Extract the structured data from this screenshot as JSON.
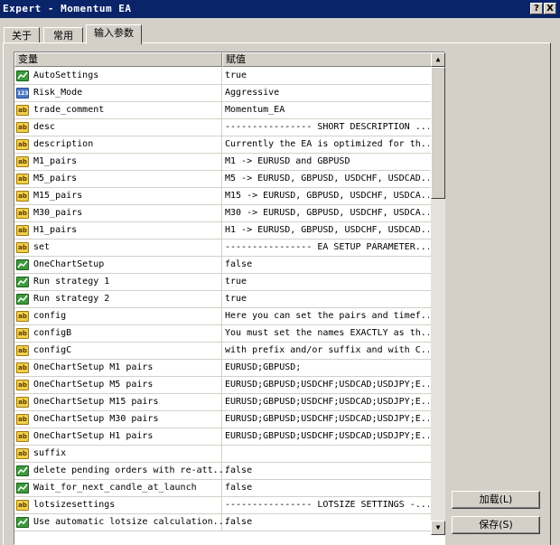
{
  "window": {
    "title": "Expert - Momentum EA",
    "help_label": "?",
    "close_label": "X"
  },
  "tabs": [
    {
      "label": "关于"
    },
    {
      "label": "常用"
    },
    {
      "label": "输入参数"
    }
  ],
  "grid": {
    "header_name": "变量",
    "header_value": "赋值",
    "scroll_up": "▲",
    "scroll_down": "▼",
    "rows": [
      {
        "type": "bool",
        "icon_text": "",
        "name": "AutoSettings",
        "value": "true"
      },
      {
        "type": "123",
        "icon_text": "123",
        "name": "Risk_Mode",
        "value": "Aggressive"
      },
      {
        "type": "ab",
        "icon_text": "ab",
        "name": "trade_comment",
        "value": "Momentum_EA"
      },
      {
        "type": "ab",
        "icon_text": "ab",
        "name": "desc",
        "value": "---------------- SHORT DESCRIPTION ..."
      },
      {
        "type": "ab",
        "icon_text": "ab",
        "name": "description",
        "value": "Currently the EA is optimized for th..."
      },
      {
        "type": "ab",
        "icon_text": "ab",
        "name": "M1_pairs",
        "value": "M1 -> EURUSD and GBPUSD"
      },
      {
        "type": "ab",
        "icon_text": "ab",
        "name": "M5_pairs",
        "value": "M5 -> EURUSD, GBPUSD, USDCHF, USDCAD..."
      },
      {
        "type": "ab",
        "icon_text": "ab",
        "name": "M15_pairs",
        "value": "M15 -> EURUSD, GBPUSD, USDCHF, USDCA..."
      },
      {
        "type": "ab",
        "icon_text": "ab",
        "name": "M30_pairs",
        "value": "M30 -> EURUSD, GBPUSD, USDCHF, USDCA..."
      },
      {
        "type": "ab",
        "icon_text": "ab",
        "name": "H1_pairs",
        "value": "H1 -> EURUSD, GBPUSD, USDCHF, USDCAD..."
      },
      {
        "type": "ab",
        "icon_text": "ab",
        "name": "set",
        "value": "---------------- EA SETUP PARAMETER..."
      },
      {
        "type": "bool",
        "icon_text": "",
        "name": "OneChartSetup",
        "value": "false"
      },
      {
        "type": "bool",
        "icon_text": "",
        "name": "Run strategy 1",
        "value": "true"
      },
      {
        "type": "bool",
        "icon_text": "",
        "name": "Run strategy 2",
        "value": "true"
      },
      {
        "type": "ab",
        "icon_text": "ab",
        "name": "config",
        "value": "Here you can set the pairs and timef..."
      },
      {
        "type": "ab",
        "icon_text": "ab",
        "name": "configB",
        "value": "You must set the names EXACTLY as th..."
      },
      {
        "type": "ab",
        "icon_text": "ab",
        "name": "configC",
        "value": "with prefix and/or suffix and with C..."
      },
      {
        "type": "ab",
        "icon_text": "ab",
        "name": "OneChartSetup M1 pairs",
        "value": "EURUSD;GBPUSD;"
      },
      {
        "type": "ab",
        "icon_text": "ab",
        "name": "OneChartSetup M5 pairs",
        "value": "EURUSD;GBPUSD;USDCHF;USDCAD;USDJPY;E..."
      },
      {
        "type": "ab",
        "icon_text": "ab",
        "name": "OneChartSetup M15 pairs",
        "value": "EURUSD;GBPUSD;USDCHF;USDCAD;USDJPY;E..."
      },
      {
        "type": "ab",
        "icon_text": "ab",
        "name": "OneChartSetup M30 pairs",
        "value": "EURUSD;GBPUSD;USDCHF;USDCAD;USDJPY;E..."
      },
      {
        "type": "ab",
        "icon_text": "ab",
        "name": "OneChartSetup H1 pairs",
        "value": "EURUSD;GBPUSD;USDCHF;USDCAD;USDJPY;E..."
      },
      {
        "type": "ab",
        "icon_text": "ab",
        "name": "suffix",
        "value": ""
      },
      {
        "type": "bool",
        "icon_text": "",
        "name": "delete pending orders with re-att...",
        "value": "false"
      },
      {
        "type": "bool",
        "icon_text": "",
        "name": "Wait_for_next_candle_at_launch",
        "value": "false"
      },
      {
        "type": "ab",
        "icon_text": "ab",
        "name": "lotsizesettings",
        "value": "---------------- LOTSIZE SETTINGS -..."
      },
      {
        "type": "bool",
        "icon_text": "",
        "name": "Use automatic lotsize calculation...",
        "value": "false"
      }
    ]
  },
  "buttons": {
    "load_label": "加载(L)",
    "save_label": "保存(S)"
  },
  "colors": {
    "titlebar": "#0a246a",
    "face": "#d4d0c8",
    "string_icon": "#f2cf4a",
    "bool_icon": "#3c9a3c",
    "enum_icon": "#4a78c8"
  }
}
